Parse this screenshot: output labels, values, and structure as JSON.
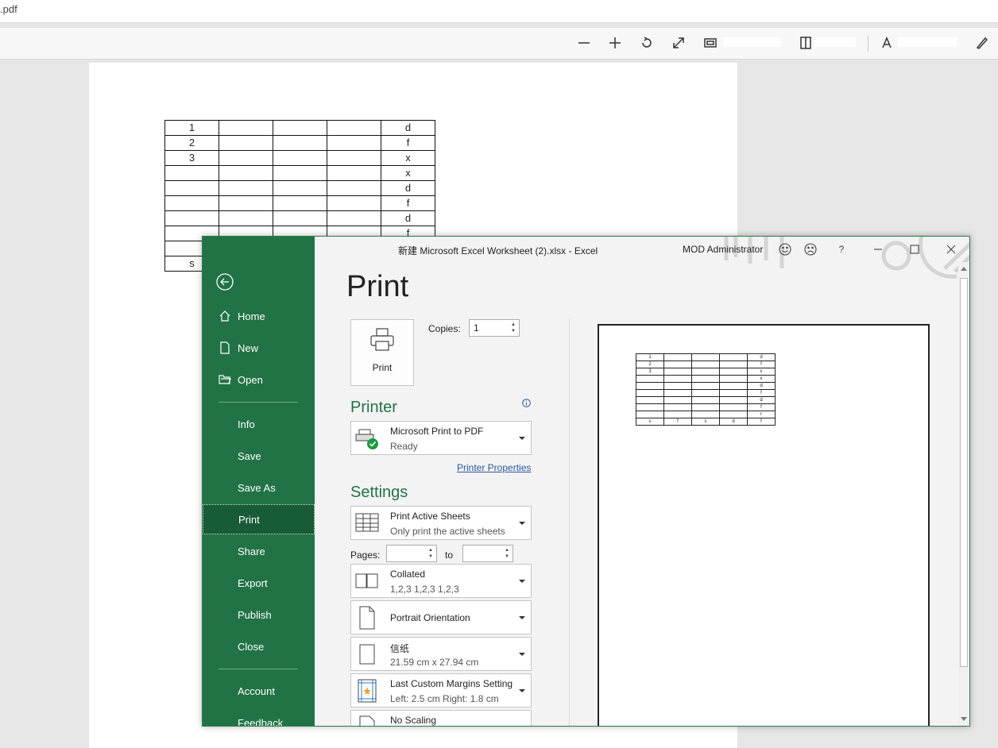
{
  "pdf": {
    "title": ".pdf",
    "toolbar": {
      "zoom_out": "zoom-out",
      "zoom_in": "zoom-in"
    },
    "table": [
      [
        "1",
        "",
        "",
        "",
        "d"
      ],
      [
        "2",
        "",
        "",
        "",
        "f"
      ],
      [
        "3",
        "",
        "",
        "",
        "x"
      ],
      [
        "",
        "",
        "",
        "",
        "x"
      ],
      [
        "",
        "",
        "",
        "",
        "d"
      ],
      [
        "",
        "",
        "",
        "",
        "f"
      ],
      [
        "",
        "",
        "",
        "",
        "d"
      ],
      [
        "",
        "",
        "",
        "",
        "f"
      ],
      [
        "",
        "",
        "",
        "",
        ""
      ],
      [
        "s",
        "",
        "",
        "",
        ""
      ]
    ]
  },
  "excel": {
    "title": "新建 Microsoft Excel Worksheet (2).xlsx  -  Excel",
    "user": "MOD Administrator",
    "help": "?",
    "nav": {
      "home": "Home",
      "new": "New",
      "open": "Open",
      "info": "Info",
      "save": "Save",
      "save_as": "Save As",
      "print": "Print",
      "share": "Share",
      "export": "Export",
      "publish": "Publish",
      "close": "Close",
      "account": "Account",
      "feedback": "Feedback"
    },
    "print_page": {
      "heading": "Print",
      "print_button": "Print",
      "copies_label": "Copies:",
      "copies_value": "1",
      "printer_heading": "Printer",
      "printer_name": "Microsoft Print to PDF",
      "printer_status": "Ready",
      "printer_properties": "Printer Properties",
      "settings_heading": "Settings",
      "what": {
        "title": "Print Active Sheets",
        "sub": "Only print the active sheets"
      },
      "pages_label": "Pages:",
      "to_label": "to",
      "collate": {
        "title": "Collated",
        "sub": "1,2,3    1,2,3    1,2,3"
      },
      "orientation": "Portrait Orientation",
      "paper": {
        "title": "信纸",
        "sub": "21.59 cm x 27.94 cm"
      },
      "margins": {
        "title": "Last Custom Margins Setting",
        "sub": "Left:  2.5 cm    Right:  1.8 cm"
      },
      "scaling": "No Scaling"
    },
    "preview_table": [
      [
        "1",
        "",
        "",
        "",
        "d"
      ],
      [
        "2",
        "",
        "",
        "",
        "f"
      ],
      [
        "3",
        "",
        "",
        "",
        "x"
      ],
      [
        "",
        "",
        "",
        "",
        "x"
      ],
      [
        "",
        "",
        "",
        "",
        "d"
      ],
      [
        "",
        "",
        "",
        "",
        "f"
      ],
      [
        "",
        "",
        "",
        "",
        "d"
      ],
      [
        "",
        "",
        "",
        "",
        "f"
      ],
      [
        "",
        "",
        "",
        "",
        "r"
      ],
      [
        "s",
        "f",
        "s",
        "d",
        "f"
      ]
    ]
  }
}
